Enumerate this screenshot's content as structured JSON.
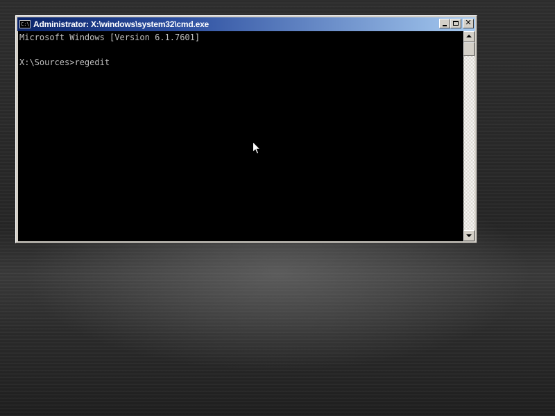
{
  "window": {
    "title": "Administrator: X:\\windows\\system32\\cmd.exe",
    "icon": "cmd-icon",
    "icon_text": "C:\\"
  },
  "console": {
    "lines": [
      "Microsoft Windows [Version 6.1.7601]",
      "",
      "X:\\Sources>regedit"
    ],
    "text_color": "#c0c0c0",
    "background": "#000000"
  },
  "title_buttons": {
    "minimize": "minimize-icon",
    "maximize": "maximize-icon",
    "close": "close-icon",
    "close_glyph": "✕"
  },
  "colors": {
    "title_bar_start": "#0a246a",
    "title_bar_end": "#a6caf0",
    "window_face": "#d4d0c8"
  }
}
